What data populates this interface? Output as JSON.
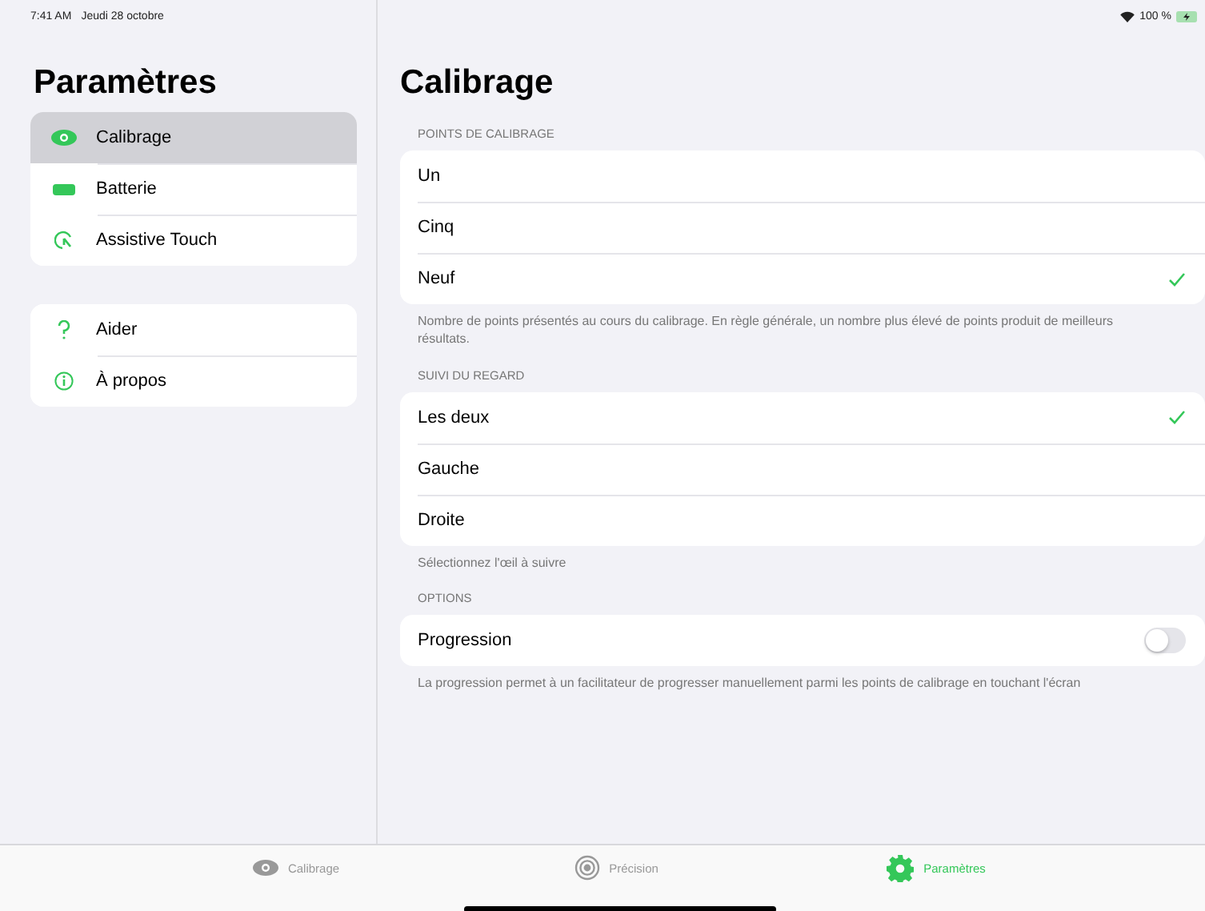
{
  "status_bar": {
    "time": "7:41 AM",
    "date": "Jeudi 28 octobre",
    "battery": "100 %"
  },
  "sidebar": {
    "title": "Paramètres",
    "groups": [
      {
        "items": [
          {
            "label": "Calibrage",
            "selected": true
          },
          {
            "label": "Batterie",
            "selected": false
          },
          {
            "label": "Assistive Touch",
            "selected": false
          }
        ]
      },
      {
        "items": [
          {
            "label": "Aider",
            "selected": false
          },
          {
            "label": "À propos",
            "selected": false
          }
        ]
      }
    ]
  },
  "main": {
    "title": "Calibrage",
    "sections": [
      {
        "header": "POINTS DE CALIBRAGE",
        "rows": [
          {
            "kind": "choice",
            "label": "Un",
            "checked": false
          },
          {
            "kind": "choice",
            "label": "Cinq",
            "checked": false
          },
          {
            "kind": "choice",
            "label": "Neuf",
            "checked": true
          }
        ],
        "footer": "Nombre de points présentés au cours du calibrage. En règle générale, un nombre plus élevé de points produit de meilleurs résultats."
      },
      {
        "header": "SUIVI DU REGARD",
        "rows": [
          {
            "kind": "choice",
            "label": "Les deux",
            "checked": true
          },
          {
            "kind": "choice",
            "label": "Gauche",
            "checked": false
          },
          {
            "kind": "choice",
            "label": "Droite",
            "checked": false
          }
        ],
        "footer": "Sélectionnez l'œil à suivre"
      },
      {
        "header": "OPTIONS",
        "rows": [
          {
            "kind": "toggle",
            "label": "Progression",
            "on": false
          }
        ],
        "footer": "La progression permet à un facilitateur de progresser manuellement parmi les points de calibrage en touchant l'écran"
      }
    ]
  },
  "tab_bar": [
    {
      "label": "Calibrage",
      "selected": false
    },
    {
      "label": "Précision",
      "selected": false
    },
    {
      "label": "Paramètres",
      "selected": true
    }
  ]
}
